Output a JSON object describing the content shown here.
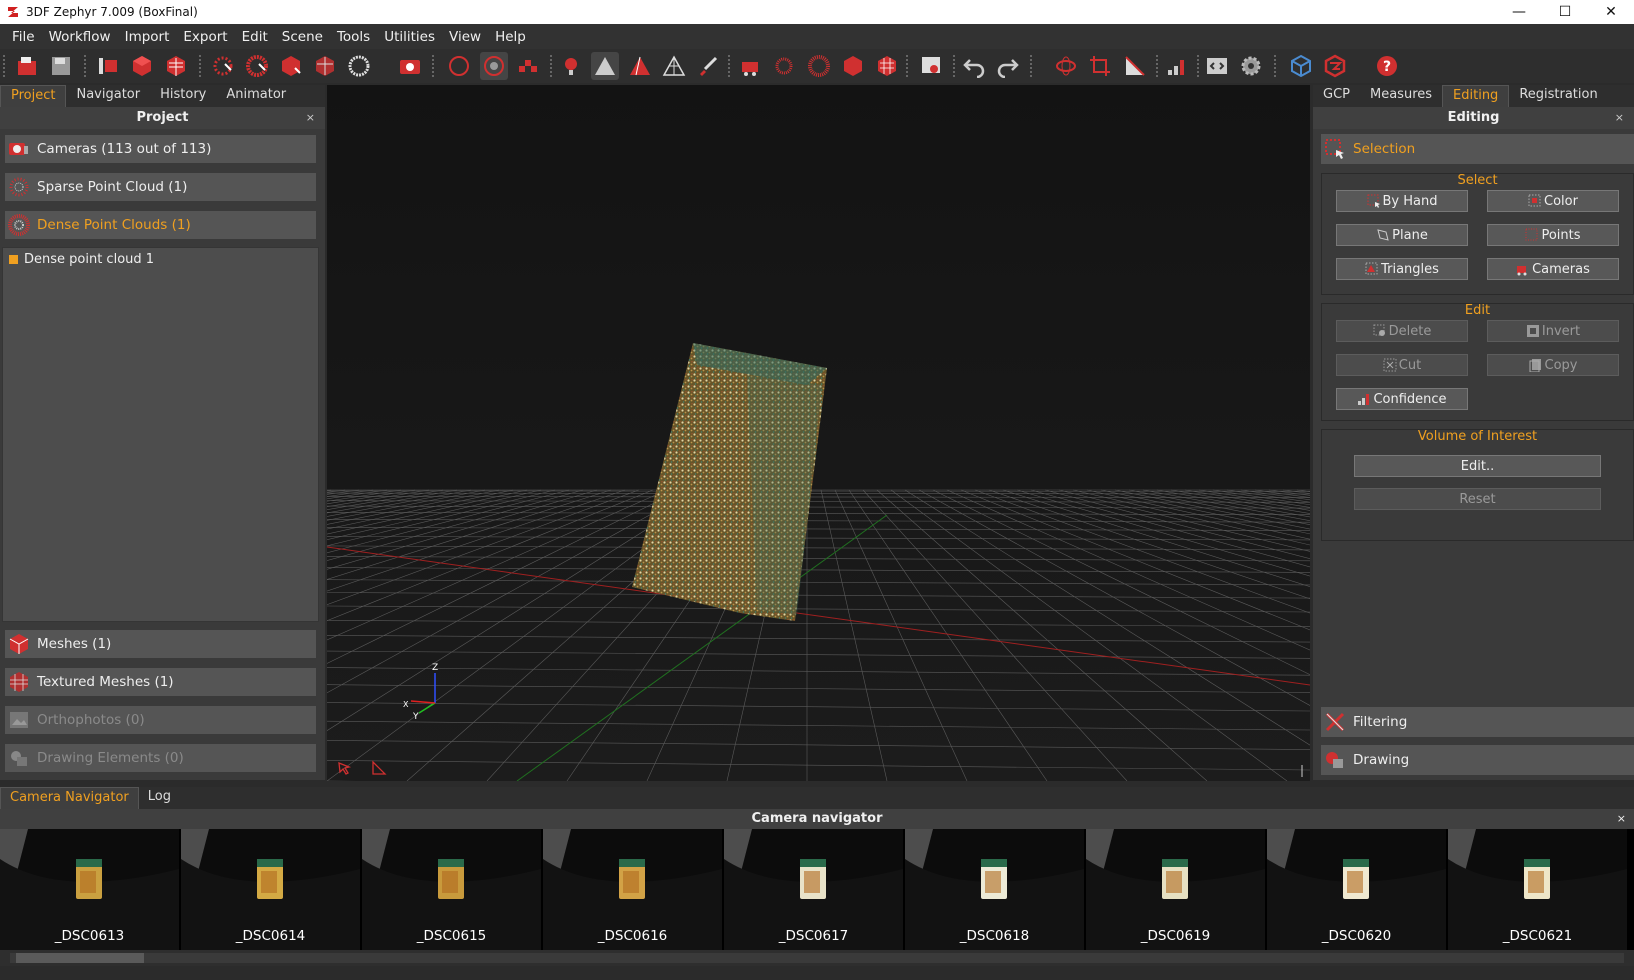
{
  "window": {
    "title": "3DF Zephyr 7.009 (BoxFinal)",
    "minimize": "—",
    "maximize": "☐",
    "close": "✕"
  },
  "menu": [
    "File",
    "Workflow",
    "Import",
    "Export",
    "Edit",
    "Scene",
    "Tools",
    "Utilities",
    "View",
    "Help"
  ],
  "left": {
    "tabs": [
      "Project",
      "Navigator",
      "History",
      "Animator"
    ],
    "active_tab": "Project",
    "panel_title": "Project",
    "close": "×",
    "sections": {
      "cameras": "Cameras (113 out of 113)",
      "sparse": "Sparse Point Cloud (1)",
      "dense": "Dense Point Clouds (1)",
      "meshes": "Meshes (1)",
      "textured": "Textured Meshes (1)",
      "ortho": "Orthophotos (0)",
      "drawing": "Drawing Elements (0)"
    },
    "tree_items": [
      "Dense point cloud 1"
    ]
  },
  "viewport": {
    "axis_z": "Z",
    "axis_y": "Y",
    "axis_x": "X"
  },
  "right": {
    "tabs": [
      "GCP",
      "Measures",
      "Editing",
      "Registration"
    ],
    "active_tab": "Editing",
    "panel_title": "Editing",
    "close": "×",
    "selection": "Selection",
    "select_group": "Select",
    "select_buttons": {
      "by_hand": "By Hand",
      "color": "Color",
      "plane": "Plane",
      "points": "Points",
      "triangles": "Triangles",
      "cameras": "Cameras"
    },
    "edit_group": "Edit",
    "edit_buttons": {
      "delete": "Delete",
      "invert": "Invert",
      "cut": "Cut",
      "copy": "Copy",
      "confidence": "Confidence"
    },
    "voi_group": "Volume of Interest",
    "voi_buttons": {
      "edit": "Edit..",
      "reset": "Reset"
    },
    "filtering": "Filtering",
    "drawing": "Drawing"
  },
  "bottom": {
    "tabs": [
      "Camera Navigator",
      "Log"
    ],
    "active_tab": "Camera Navigator",
    "panel_title": "Camera navigator",
    "close": "×",
    "thumbnails": [
      "_DSC0613",
      "_DSC0614",
      "_DSC0615",
      "_DSC0616",
      "_DSC0617",
      "_DSC0618",
      "_DSC0619",
      "_DSC0620",
      "_DSC0621"
    ]
  },
  "colors": {
    "accent": "#f0a020",
    "brand_red": "#e03030"
  }
}
